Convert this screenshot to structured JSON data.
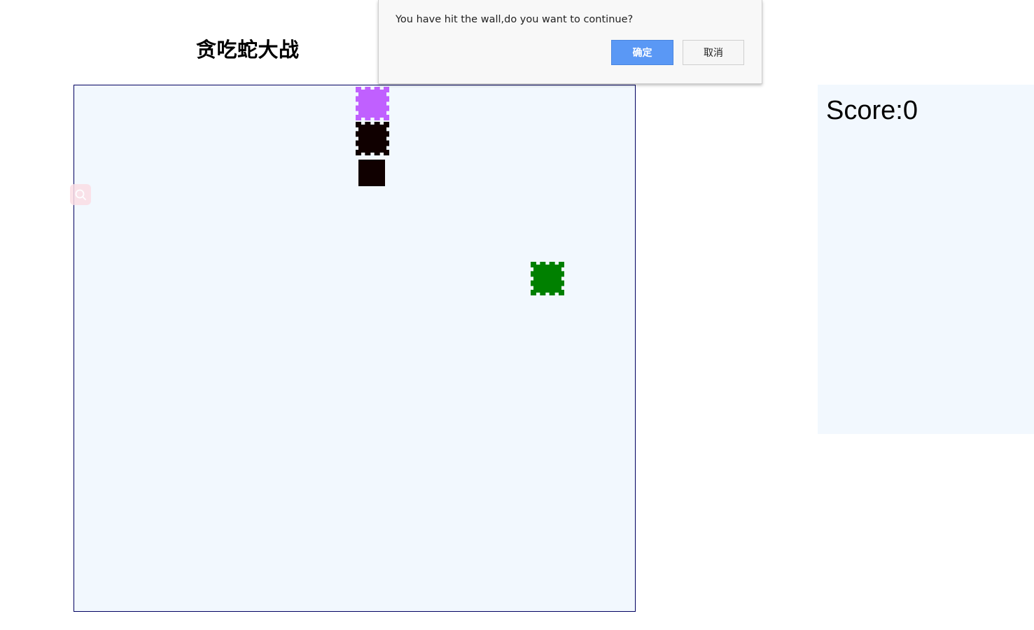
{
  "page": {
    "title": "贪吃蛇大战"
  },
  "game": {
    "board_color": "#f2f8fe",
    "border_color": "#000060",
    "grid_cell": 50,
    "snake": [
      {
        "part": "head",
        "col": 8,
        "row": 0,
        "color": "#c060ff",
        "style": "dashed"
      },
      {
        "part": "body",
        "col": 8,
        "row": 1,
        "color": "#100000",
        "style": "dashed"
      },
      {
        "part": "body",
        "col": 8,
        "row": 2,
        "color": "#100000",
        "style": "solid"
      }
    ],
    "food": {
      "col": 13,
      "row": 5,
      "color": "#008000",
      "style": "dashed"
    }
  },
  "score": {
    "label": "Score:0"
  },
  "floating_tool": {
    "icon": "search-icon",
    "color": "#fbdde5"
  },
  "dialog": {
    "message": "You have hit the wall,do you want to continue?",
    "ok_label": "确定",
    "cancel_label": "取消",
    "ok_color": "#5a98f5"
  }
}
